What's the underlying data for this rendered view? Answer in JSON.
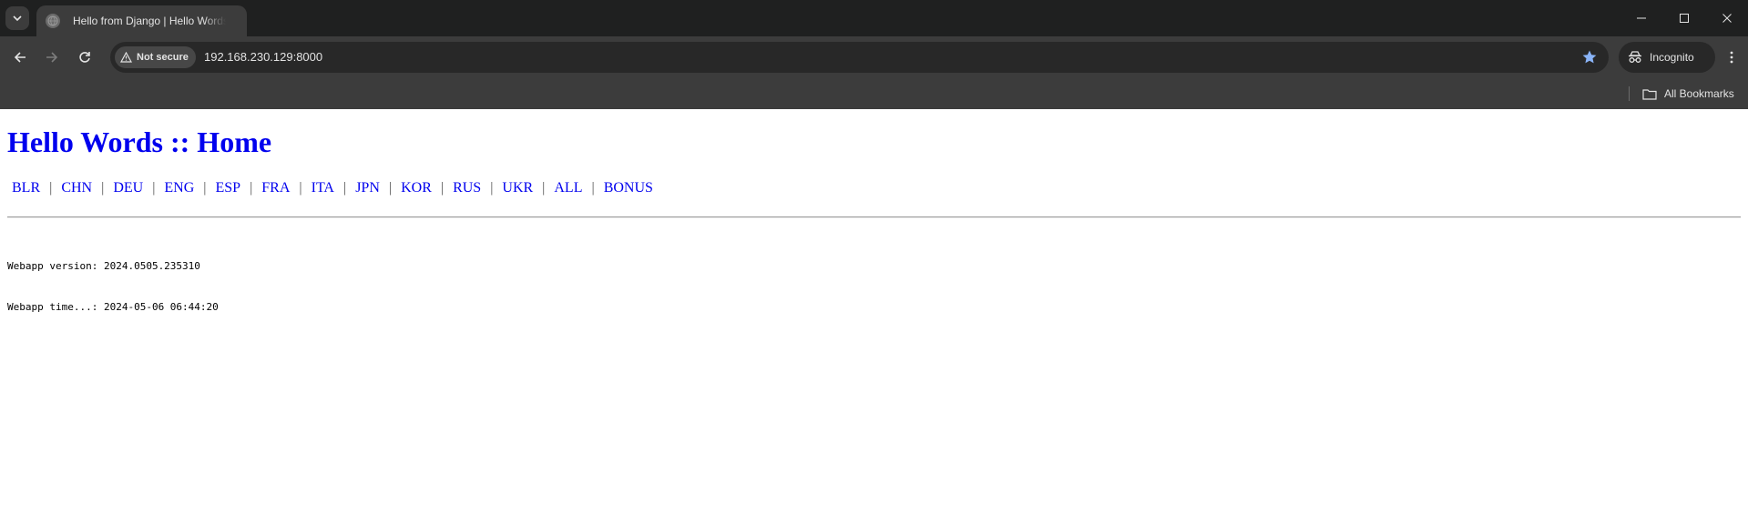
{
  "browser": {
    "tab_title": "Hello from Django | Hello Words",
    "security_label": "Not secure",
    "url": "192.168.230.129:8000",
    "incognito_label": "Incognito",
    "all_bookmarks_label": "All Bookmarks",
    "accent_color": "#8ab4f8"
  },
  "page": {
    "title": "Hello Words :: Home",
    "nav_links": [
      {
        "label": "BLR"
      },
      {
        "label": "CHN"
      },
      {
        "label": "DEU"
      },
      {
        "label": "ENG"
      },
      {
        "label": "ESP"
      },
      {
        "label": "FRA"
      },
      {
        "label": "ITA"
      },
      {
        "label": "JPN"
      },
      {
        "label": "KOR"
      },
      {
        "label": "RUS"
      },
      {
        "label": "UKR"
      },
      {
        "label": "ALL"
      },
      {
        "label": "BONUS"
      }
    ],
    "nav_separator": "|",
    "version_line": "Webapp version: 2024.0505.235310",
    "time_line": "Webapp time...: 2024-05-06 06:44:20",
    "link_color": "#0000ee"
  }
}
